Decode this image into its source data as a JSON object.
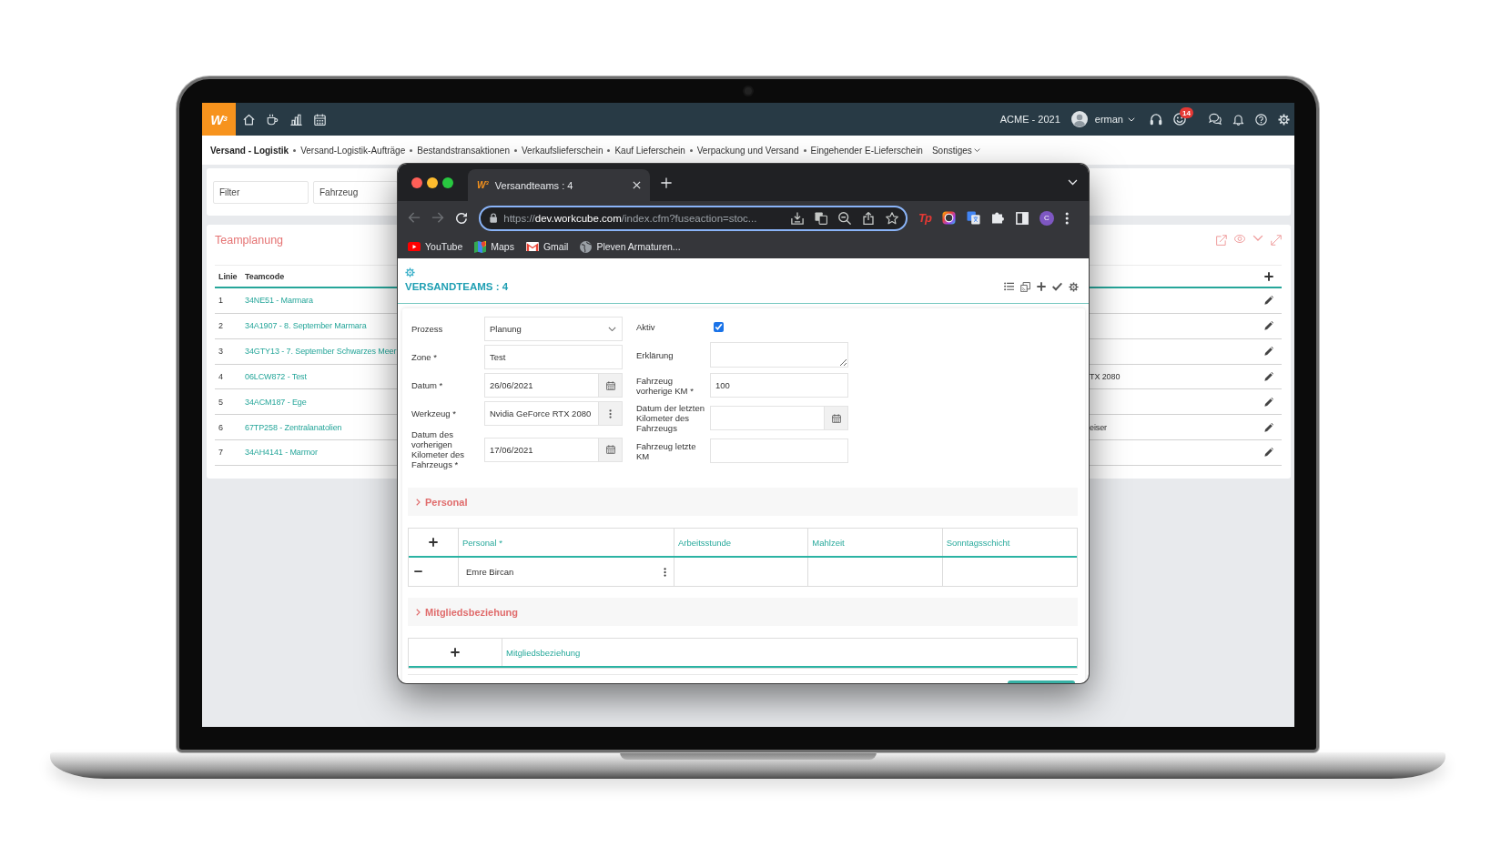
{
  "app_bar": {
    "logo": "W$^{3}$",
    "company": "ACME - 2021",
    "user": "erman",
    "notification_count": "14"
  },
  "module_nav": {
    "title": "Versand - Logistik",
    "items": [
      "Versand-Logistik-Aufträge",
      "Bestandstransaktionen",
      "Verkaufslieferschein",
      "Kauf Lieferschein",
      "Verpackung und Versand",
      "Eingehender E-Lieferschein"
    ],
    "more": "Sonstiges"
  },
  "filter_bar": {
    "fields": [
      {
        "placeholder": "Filter"
      },
      {
        "placeholder": "Fahrzeug"
      }
    ]
  },
  "team_planning": {
    "title": "Teamplanung",
    "columns": [
      "Linie",
      "Teamcode"
    ],
    "rows": [
      {
        "line": "1",
        "teamcode": "34NE51 - Marmara"
      },
      {
        "line": "2",
        "teamcode": "34A1907 - 8. September Marmara"
      },
      {
        "line": "3",
        "teamcode": "34GTY13 - 7. September Schwarzes Meer"
      },
      {
        "line": "4",
        "teamcode": "06LCW872 - Test",
        "column_3": "TX 2080"
      },
      {
        "line": "5",
        "teamcode": "34ACM187 - Ege"
      },
      {
        "line": "6",
        "teamcode": "67TP258 - Zentralanatolien",
        "column_3": "eiser"
      },
      {
        "line": "7",
        "teamcode": "34AH4141 - Marmor"
      }
    ]
  },
  "browser": {
    "tab": {
      "favicon": "W$^{3}$",
      "title": "Versandteams : 4"
    },
    "nav_buttons": [
      {
        "kind": "back",
        "disabled": true
      },
      {
        "kind": "forward",
        "disabled": true
      },
      {
        "kind": "reload",
        "disabled": false
      }
    ],
    "url": "https://**dev.workcube.com**/index.cfm?fuseaction=stoc...",
    "extension_label": "Tp",
    "profile_initial": "C",
    "bookmarks": [
      {
        "kind": "video",
        "label": "YouTube"
      },
      {
        "kind": "map",
        "label": "Maps"
      },
      {
        "kind": "mail",
        "label": "Gmail"
      },
      {
        "kind": "globe",
        "label": "Pleven Armaturen..."
      }
    ]
  },
  "page": {
    "title": "VERSANDTEAMS : 4",
    "form": {
      "left": [
        {
          "label": "Prozess",
          "kind": "select",
          "value": "Planung"
        },
        {
          "label": "Zone *",
          "kind": "text",
          "value": "Test"
        },
        {
          "label": "Datum *",
          "kind": "date",
          "value": "26/06/2021"
        },
        {
          "label": "Werkzeug *",
          "kind": "picker",
          "value": "Nvidia GeForce RTX 2080"
        },
        {
          "label": "Datum des vorherigen Kilometer des Fahrzeugs *",
          "kind": "date",
          "value": "17/06/2021"
        }
      ],
      "right": [
        {
          "label": "Aktiv",
          "kind": "checkbox",
          "checked": true
        },
        {
          "label": "Erklärung",
          "kind": "textarea"
        },
        {
          "label": "Fahrzeug vorherige KM *",
          "kind": "text",
          "value": "100"
        },
        {
          "label": "Datum der letzten Kilometer des Fahrzeugs",
          "kind": "date"
        },
        {
          "label": "Fahrzeug letzte KM",
          "kind": "text"
        }
      ]
    },
    "sections": [
      {
        "title": "Personal",
        "table": {
          "columns": [
            "Personal *",
            "Arbeitsstunde",
            "Mahlzeit",
            "Sonntagsschicht"
          ],
          "rows": [
            {
              "personal": "Emre Bircan"
            }
          ]
        }
      },
      {
        "title": "Mitgliedsbeziehung",
        "table": {
          "columns": [
            "Mitgliedsbeziehung"
          ]
        }
      }
    ]
  }
}
